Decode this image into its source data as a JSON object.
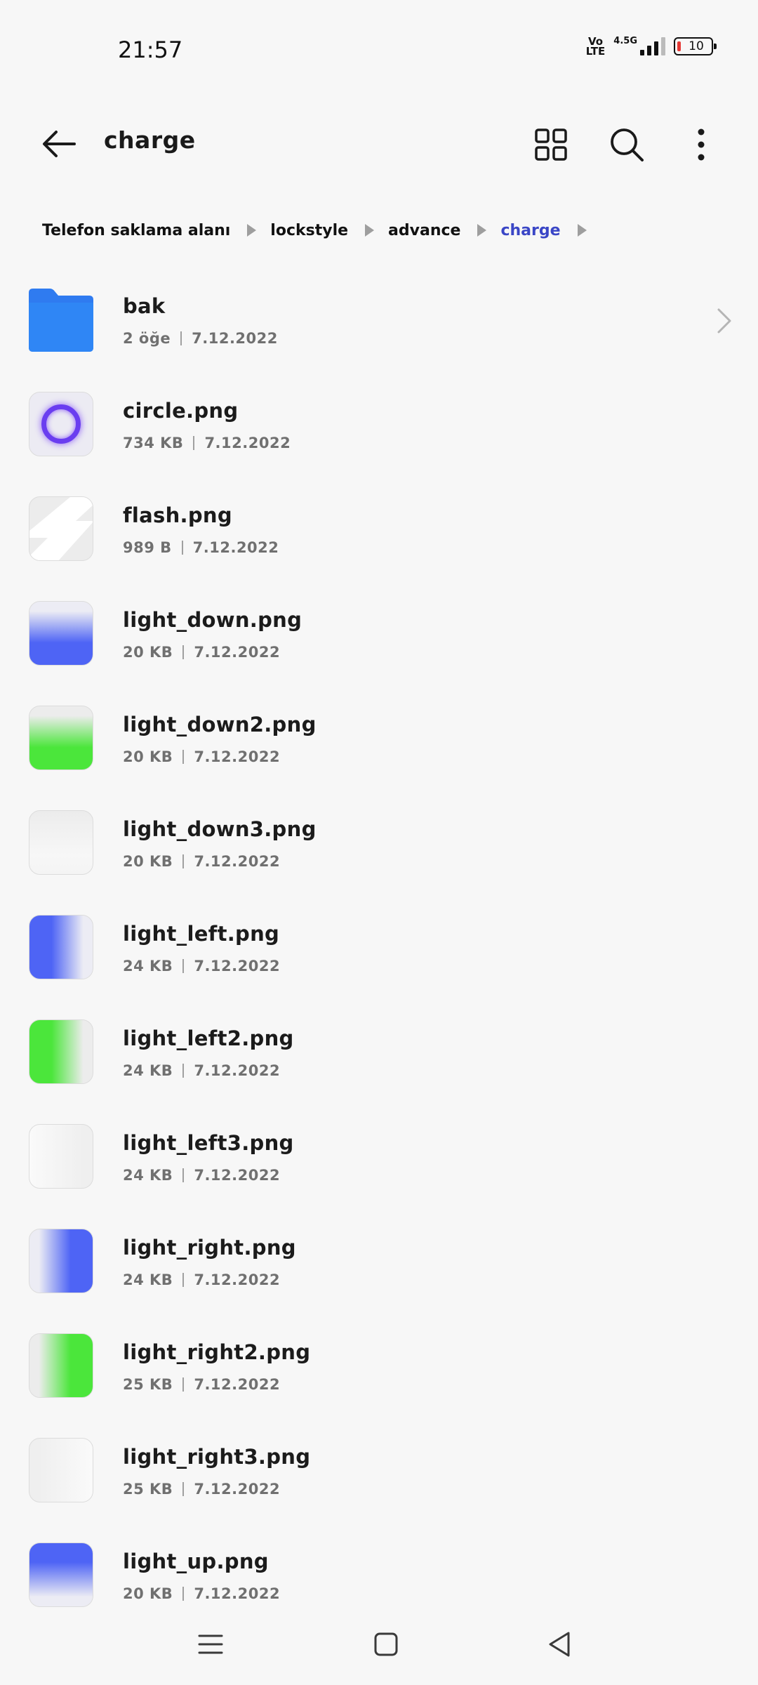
{
  "status_bar": {
    "time": "21:57",
    "volte_top": "Vo",
    "volte_bottom": "LTE",
    "network": "4.5G",
    "battery_level": "10"
  },
  "app_bar": {
    "title": "charge",
    "icons": [
      "back-arrow-icon",
      "grid-view-icon",
      "search-icon",
      "more-vertical-icon"
    ]
  },
  "breadcrumb": [
    {
      "label": "Telefon saklama alanı"
    },
    {
      "label": "lockstyle"
    },
    {
      "label": "advance"
    },
    {
      "label": "charge"
    }
  ],
  "files": [
    {
      "name": "bak",
      "size": "2 öğe",
      "date": "7.12.2022",
      "kind": "folder"
    },
    {
      "name": "circle.png",
      "size": "734 KB",
      "date": "7.12.2022",
      "kind": "image"
    },
    {
      "name": "flash.png",
      "size": "989 B",
      "date": "7.12.2022",
      "kind": "image"
    },
    {
      "name": "light_down.png",
      "size": "20 KB",
      "date": "7.12.2022",
      "kind": "image"
    },
    {
      "name": "light_down2.png",
      "size": "20 KB",
      "date": "7.12.2022",
      "kind": "image"
    },
    {
      "name": "light_down3.png",
      "size": "20 KB",
      "date": "7.12.2022",
      "kind": "image"
    },
    {
      "name": "light_left.png",
      "size": "24 KB",
      "date": "7.12.2022",
      "kind": "image"
    },
    {
      "name": "light_left2.png",
      "size": "24 KB",
      "date": "7.12.2022",
      "kind": "image"
    },
    {
      "name": "light_left3.png",
      "size": "24 KB",
      "date": "7.12.2022",
      "kind": "image"
    },
    {
      "name": "light_right.png",
      "size": "24 KB",
      "date": "7.12.2022",
      "kind": "image"
    },
    {
      "name": "light_right2.png",
      "size": "25 KB",
      "date": "7.12.2022",
      "kind": "image"
    },
    {
      "name": "light_right3.png",
      "size": "25 KB",
      "date": "7.12.2022",
      "kind": "image"
    },
    {
      "name": "light_up.png",
      "size": "20 KB",
      "date": "7.12.2022",
      "kind": "image"
    }
  ],
  "colors": {
    "accent": "#3a46c6",
    "folder": "#2f7bf0",
    "background": "#f7f7f7"
  }
}
